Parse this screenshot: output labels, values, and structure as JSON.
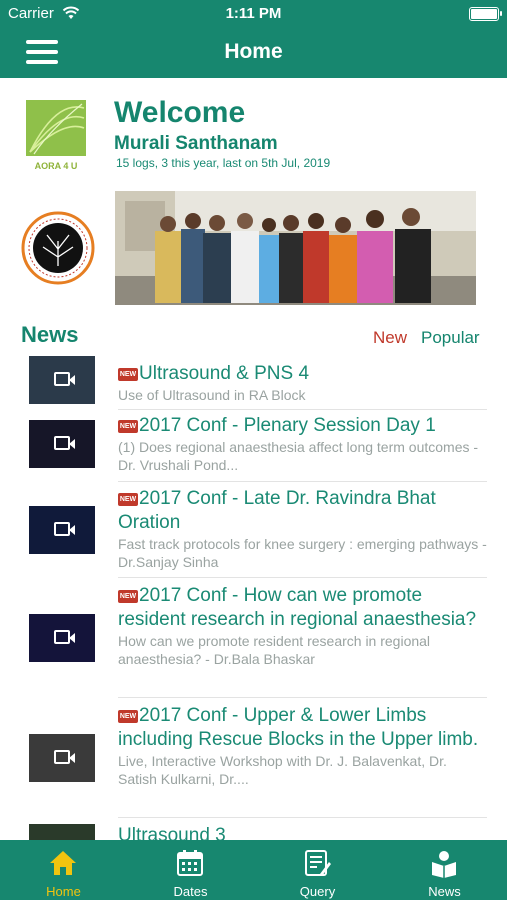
{
  "status_bar": {
    "carrier": "Carrier",
    "time": "1:11 PM"
  },
  "nav": {
    "title": "Home",
    "menu_icon": "hamburger-menu-icon"
  },
  "profile": {
    "welcome": "Welcome",
    "name": "Murali Santhanam",
    "log_info": "15 logs, 3 this year,  last on 5th Jul, 2019",
    "logo_text": "AORA 4 U"
  },
  "news": {
    "heading": "News",
    "tab_new": "New",
    "tab_popular": "Popular",
    "badge": "NEW",
    "items": [
      {
        "title": "Ultrasound & PNS 4",
        "desc": "Use of Ultrasound in RA Block",
        "new": true
      },
      {
        "title": "2017 Conf - Plenary Session Day 1",
        "desc": "(1) Does regional anaesthesia affect long term outcomes - Dr. Vrushali Pond...",
        "new": true
      },
      {
        "title": "2017 Conf - Late Dr. Ravindra Bhat Oration",
        "desc": "Fast track protocols for knee surgery : emerging pathways - Dr.Sanjay Sinha",
        "new": true
      },
      {
        "title": "2017 Conf - How can we promote resident research in regional anaesthesia?",
        "desc": "How can we promote resident research in regional anaesthesia? - Dr.Bala Bhaskar",
        "new": true
      },
      {
        "title": "2017 Conf - Upper & Lower Limbs including Rescue Blocks in the Upper limb.",
        "desc": "Live, Interactive Workshop with Dr. J. Balavenkat, Dr. Satish Kulkarni, Dr....",
        "new": true
      },
      {
        "title": "Ultrasound 3",
        "desc": "",
        "new": false
      }
    ]
  },
  "tabs": [
    {
      "label": "Home",
      "icon": "home-icon",
      "active": true
    },
    {
      "label": "Dates",
      "icon": "calendar-icon",
      "active": false
    },
    {
      "label": "Query",
      "icon": "query-icon",
      "active": false
    },
    {
      "label": "News",
      "icon": "news-reader-icon",
      "active": false
    }
  ],
  "colors": {
    "primary": "#17876f",
    "accent_new": "#c0392b",
    "active_tab": "#f1c40f"
  }
}
